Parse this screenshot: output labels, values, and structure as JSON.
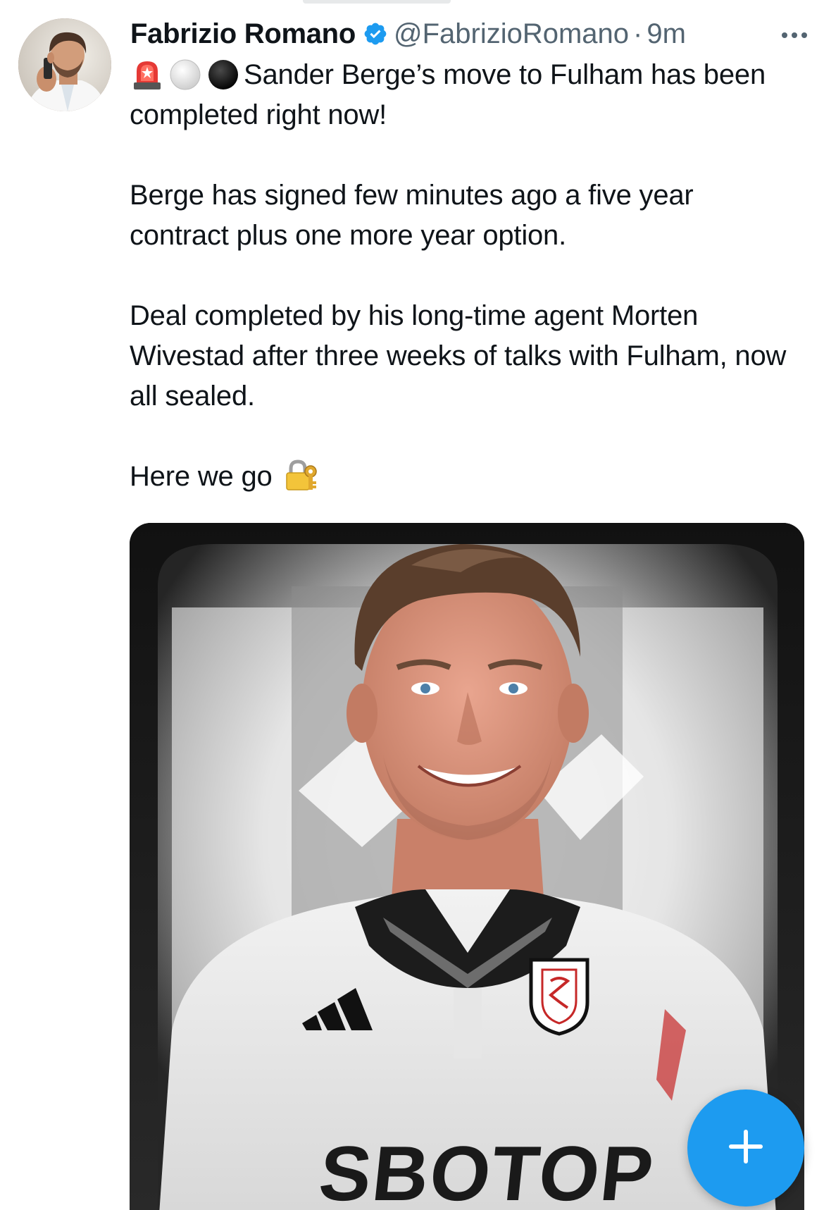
{
  "tweet": {
    "author": {
      "display_name": "Fabrizio Romano",
      "verified_icon": "verified-badge-icon",
      "handle": "@FabrizioRomano",
      "separator": "·",
      "time": "9m"
    },
    "menu_icon": "more-horizontal-icon",
    "paragraphs": [
      {
        "emojis": [
          "police-light-emoji",
          "white-circle-emoji",
          "black-circle-emoji"
        ],
        "text": "Sander Berge’s move to Fulham has been completed right now!"
      },
      {
        "text": "Berge has signed few minutes ago a five year contract plus one more year option."
      },
      {
        "text": "Deal completed by his long-time agent Morten Wivestad after three weeks of talks with Fulham, now all sealed."
      },
      {
        "text": "Here we go",
        "trailing_emoji": "lock-with-key-emoji"
      }
    ],
    "media": {
      "type": "photo",
      "sponsor_text": "SBOTOP"
    }
  },
  "fab": {
    "icon": "plus-icon",
    "color": "#1d9bf0"
  },
  "colors": {
    "text_primary": "#0f1419",
    "text_secondary": "#536471",
    "verified_blue": "#1d9bf0"
  }
}
